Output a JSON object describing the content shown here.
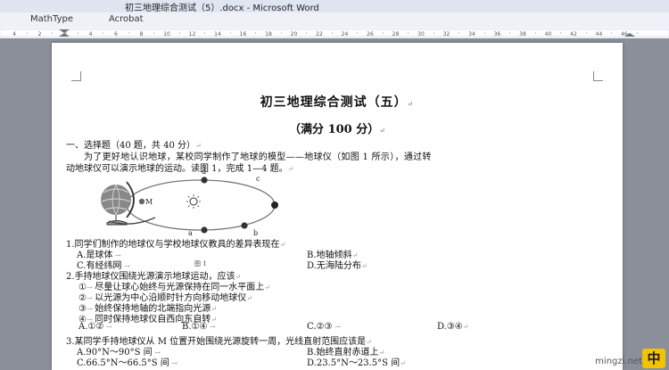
{
  "window": {
    "title": "初三地理综合测试（5）.docx - Microsoft Word"
  },
  "menu": {
    "items": [
      "MathType",
      "Acrobat"
    ]
  },
  "ruler": {
    "numbers": [
      "4",
      "2",
      "2",
      "4",
      "6",
      "8",
      "10",
      "12",
      "14",
      "16",
      "18",
      "20",
      "22",
      "24",
      "26",
      "28",
      "30",
      "32",
      "34",
      "36",
      "38",
      "40",
      "42",
      "44",
      "46"
    ]
  },
  "document": {
    "title": "初三地理综合测试（五）",
    "subtitle": "（满分 100 分）",
    "section1": "一、选择题（40 题，共 40 分）",
    "intro1": "为了更好地认识地球，某校同学制作了地球的模型——地球仪（如图 1 所示），通过转",
    "intro2": "动地球仪可以演示地球的运动。读图 1，完成 1—4 题。",
    "figure": {
      "caption": "图 1",
      "labels": {
        "d": "d",
        "c": "c",
        "M": "M",
        "a": "a",
        "b": "b"
      }
    },
    "q1": {
      "stem": "1.同学们制作的地球仪与学校地球仪教具的差异表现在",
      "A": "A.是球体",
      "B": "B.地轴倾斜",
      "C": "C.有经纬网",
      "D": "D.无海陆分布"
    },
    "q2": {
      "stem": "2.手持地球仪围绕光源演示地球运动，应该",
      "s1": "尽量让球心始终与光源保持在同一水平面上",
      "s2": "以光源为中心沿顺时针方向移动地球仪",
      "s3": "始终保持地轴的北端指向光源",
      "s4": "同时保持地球仪自西向东自转",
      "n1": "①",
      "n2": "②",
      "n3": "③",
      "n4": "④",
      "A": "A.①②",
      "B": "B.①④",
      "C": "C.②③",
      "D": "D.③④"
    },
    "q3": {
      "stem": "3.某同学手持地球仪从 M 位置开始围绕光源旋转一周，光线直射范围应该是",
      "A": "A.90°N～90°S 间",
      "B": "B.始终直射赤道上",
      "C": "C.66.5°N～66.5°S 间",
      "D": "D.23.5°N～23.5°S 间"
    }
  },
  "watermark": "mingzi.net",
  "badge": "中"
}
